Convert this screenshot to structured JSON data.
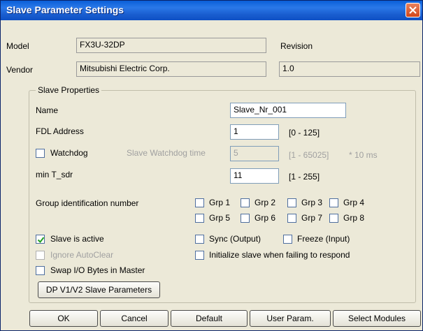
{
  "window": {
    "title": "Slave Parameter Settings"
  },
  "info": {
    "model_label": "Model",
    "model_value": "FX3U-32DP",
    "revision_label": "Revision",
    "vendor_label": "Vendor",
    "vendor_value": "Mitsubishi Electric Corp.",
    "revision_value": "1.0"
  },
  "slave_properties": {
    "group_title": "Slave Properties",
    "name_label": "Name",
    "name_value": "Slave_Nr_001",
    "fdl_label": "FDL Address",
    "fdl_value": "1",
    "fdl_range": "[0 - 125]",
    "watchdog_label": "Watchdog",
    "watchdog_checked": false,
    "watchdog_time_label": "Slave Watchdog time",
    "watchdog_time_value": "5",
    "watchdog_time_range": "[1 - 65025]",
    "watchdog_time_unit": "* 10 ms",
    "min_tsdr_label": "min T_sdr",
    "min_tsdr_value": "11",
    "min_tsdr_range": "[1 - 255]",
    "group_id_label": "Group identification number",
    "groups": [
      "Grp 1",
      "Grp 2",
      "Grp 3",
      "Grp 4",
      "Grp 5",
      "Grp 6",
      "Grp 7",
      "Grp 8"
    ],
    "slave_active_label": "Slave is active",
    "slave_active_checked": true,
    "sync_label": "Sync (Output)",
    "freeze_label": "Freeze (Input)",
    "ignore_autoclear_label": "Ignore AutoClear",
    "init_slave_label": "Initialize slave when failing to respond",
    "swap_io_label": "Swap I/O Bytes in Master",
    "dpv1_button": "DP V1/V2 Slave Parameters"
  },
  "buttons": {
    "ok": "OK",
    "cancel": "Cancel",
    "default": "Default",
    "user_param": "User Param.",
    "select_modules": "Select Modules"
  },
  "colors": {
    "titlebar": "#0a5fd8",
    "dialog_bg": "#ece9d8",
    "close_button": "#d2461a"
  }
}
